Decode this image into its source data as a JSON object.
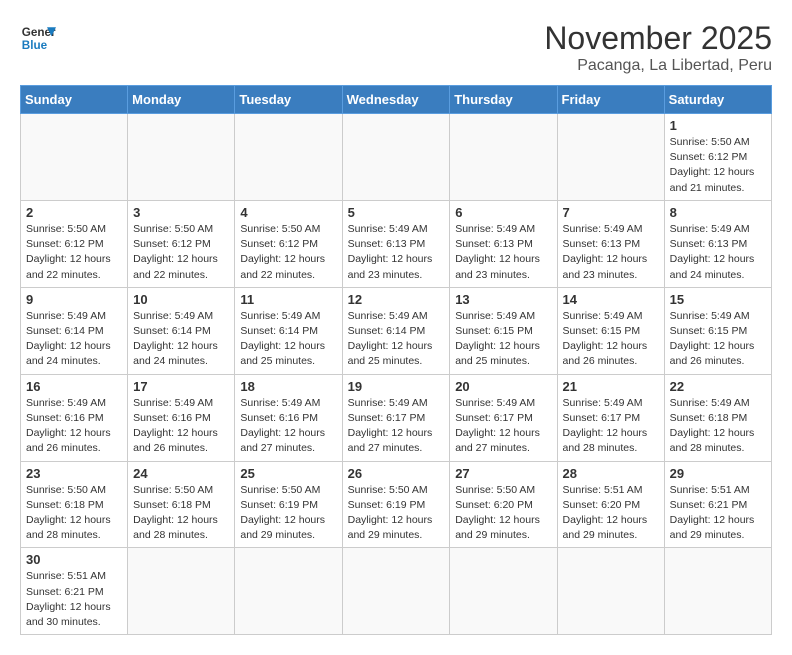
{
  "header": {
    "logo_general": "General",
    "logo_blue": "Blue",
    "month_title": "November 2025",
    "subtitle": "Pacanga, La Libertad, Peru"
  },
  "weekdays": [
    "Sunday",
    "Monday",
    "Tuesday",
    "Wednesday",
    "Thursday",
    "Friday",
    "Saturday"
  ],
  "weeks": [
    [
      {
        "day": "",
        "info": ""
      },
      {
        "day": "",
        "info": ""
      },
      {
        "day": "",
        "info": ""
      },
      {
        "day": "",
        "info": ""
      },
      {
        "day": "",
        "info": ""
      },
      {
        "day": "",
        "info": ""
      },
      {
        "day": "1",
        "info": "Sunrise: 5:50 AM\nSunset: 6:12 PM\nDaylight: 12 hours and 21 minutes."
      }
    ],
    [
      {
        "day": "2",
        "info": "Sunrise: 5:50 AM\nSunset: 6:12 PM\nDaylight: 12 hours and 22 minutes."
      },
      {
        "day": "3",
        "info": "Sunrise: 5:50 AM\nSunset: 6:12 PM\nDaylight: 12 hours and 22 minutes."
      },
      {
        "day": "4",
        "info": "Sunrise: 5:50 AM\nSunset: 6:12 PM\nDaylight: 12 hours and 22 minutes."
      },
      {
        "day": "5",
        "info": "Sunrise: 5:49 AM\nSunset: 6:13 PM\nDaylight: 12 hours and 23 minutes."
      },
      {
        "day": "6",
        "info": "Sunrise: 5:49 AM\nSunset: 6:13 PM\nDaylight: 12 hours and 23 minutes."
      },
      {
        "day": "7",
        "info": "Sunrise: 5:49 AM\nSunset: 6:13 PM\nDaylight: 12 hours and 23 minutes."
      },
      {
        "day": "8",
        "info": "Sunrise: 5:49 AM\nSunset: 6:13 PM\nDaylight: 12 hours and 24 minutes."
      }
    ],
    [
      {
        "day": "9",
        "info": "Sunrise: 5:49 AM\nSunset: 6:14 PM\nDaylight: 12 hours and 24 minutes."
      },
      {
        "day": "10",
        "info": "Sunrise: 5:49 AM\nSunset: 6:14 PM\nDaylight: 12 hours and 24 minutes."
      },
      {
        "day": "11",
        "info": "Sunrise: 5:49 AM\nSunset: 6:14 PM\nDaylight: 12 hours and 25 minutes."
      },
      {
        "day": "12",
        "info": "Sunrise: 5:49 AM\nSunset: 6:14 PM\nDaylight: 12 hours and 25 minutes."
      },
      {
        "day": "13",
        "info": "Sunrise: 5:49 AM\nSunset: 6:15 PM\nDaylight: 12 hours and 25 minutes."
      },
      {
        "day": "14",
        "info": "Sunrise: 5:49 AM\nSunset: 6:15 PM\nDaylight: 12 hours and 26 minutes."
      },
      {
        "day": "15",
        "info": "Sunrise: 5:49 AM\nSunset: 6:15 PM\nDaylight: 12 hours and 26 minutes."
      }
    ],
    [
      {
        "day": "16",
        "info": "Sunrise: 5:49 AM\nSunset: 6:16 PM\nDaylight: 12 hours and 26 minutes."
      },
      {
        "day": "17",
        "info": "Sunrise: 5:49 AM\nSunset: 6:16 PM\nDaylight: 12 hours and 26 minutes."
      },
      {
        "day": "18",
        "info": "Sunrise: 5:49 AM\nSunset: 6:16 PM\nDaylight: 12 hours and 27 minutes."
      },
      {
        "day": "19",
        "info": "Sunrise: 5:49 AM\nSunset: 6:17 PM\nDaylight: 12 hours and 27 minutes."
      },
      {
        "day": "20",
        "info": "Sunrise: 5:49 AM\nSunset: 6:17 PM\nDaylight: 12 hours and 27 minutes."
      },
      {
        "day": "21",
        "info": "Sunrise: 5:49 AM\nSunset: 6:17 PM\nDaylight: 12 hours and 28 minutes."
      },
      {
        "day": "22",
        "info": "Sunrise: 5:49 AM\nSunset: 6:18 PM\nDaylight: 12 hours and 28 minutes."
      }
    ],
    [
      {
        "day": "23",
        "info": "Sunrise: 5:50 AM\nSunset: 6:18 PM\nDaylight: 12 hours and 28 minutes."
      },
      {
        "day": "24",
        "info": "Sunrise: 5:50 AM\nSunset: 6:18 PM\nDaylight: 12 hours and 28 minutes."
      },
      {
        "day": "25",
        "info": "Sunrise: 5:50 AM\nSunset: 6:19 PM\nDaylight: 12 hours and 29 minutes."
      },
      {
        "day": "26",
        "info": "Sunrise: 5:50 AM\nSunset: 6:19 PM\nDaylight: 12 hours and 29 minutes."
      },
      {
        "day": "27",
        "info": "Sunrise: 5:50 AM\nSunset: 6:20 PM\nDaylight: 12 hours and 29 minutes."
      },
      {
        "day": "28",
        "info": "Sunrise: 5:51 AM\nSunset: 6:20 PM\nDaylight: 12 hours and 29 minutes."
      },
      {
        "day": "29",
        "info": "Sunrise: 5:51 AM\nSunset: 6:21 PM\nDaylight: 12 hours and 29 minutes."
      }
    ],
    [
      {
        "day": "30",
        "info": "Sunrise: 5:51 AM\nSunset: 6:21 PM\nDaylight: 12 hours and 30 minutes."
      },
      {
        "day": "",
        "info": ""
      },
      {
        "day": "",
        "info": ""
      },
      {
        "day": "",
        "info": ""
      },
      {
        "day": "",
        "info": ""
      },
      {
        "day": "",
        "info": ""
      },
      {
        "day": "",
        "info": ""
      }
    ]
  ]
}
